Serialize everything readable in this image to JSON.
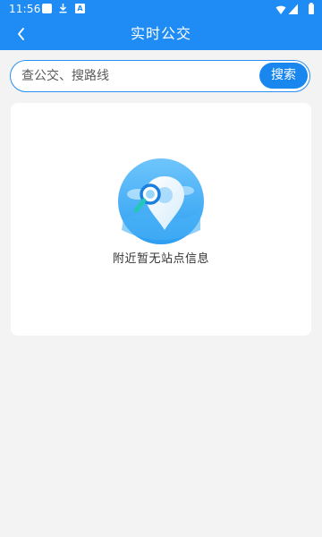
{
  "status_bar": {
    "time": "11:56",
    "download_icon": "download-icon",
    "a_badge_text": "A",
    "wifi_icon": "wifi-icon",
    "cell_icon": "cell-signal-icon",
    "battery_icon": "battery-icon"
  },
  "header": {
    "title": "实时公交",
    "back_icon": "chevron-left-icon"
  },
  "search": {
    "placeholder": "查公交、搜路线",
    "value": "",
    "button_label": "搜索"
  },
  "empty_state": {
    "icon": "location-search-icon",
    "message": "附近暂无站点信息"
  },
  "colors": {
    "primary": "#1e8cf4",
    "search_button": "#1a87ef",
    "page_background": "#f3f3f3",
    "card_background": "#ffffff"
  }
}
